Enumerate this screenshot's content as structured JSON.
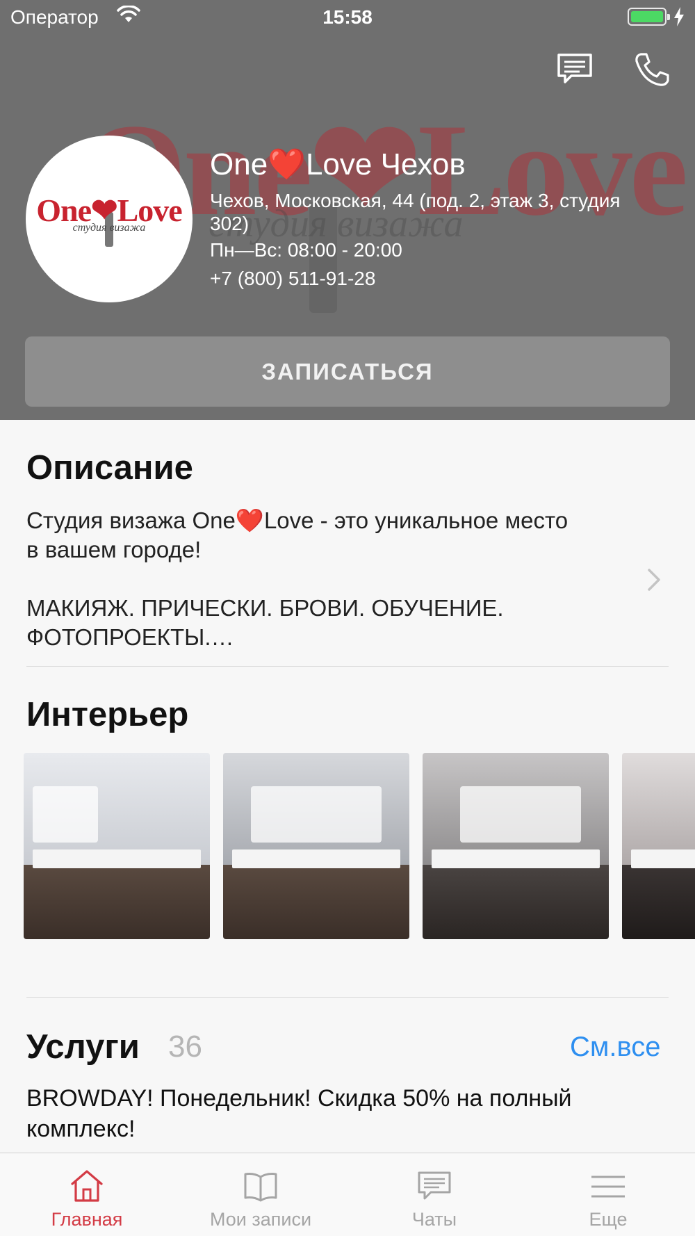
{
  "status_bar": {
    "carrier": "Оператор",
    "time": "15:58"
  },
  "header": {
    "background_logo_text": "One❤Love",
    "background_logo_subtitle": "студия визажа",
    "avatar_logo_text": "One❤Love",
    "avatar_logo_subtitle": "студия визажа",
    "name": "One❤️Love Чехов",
    "address": "Чехов, Московская, 44 (под. 2, этаж 3, студия 302)",
    "hours": "Пн—Вс: 08:00 - 20:00",
    "phone": "+7 (800) 511-91-28",
    "book_button": "ЗАПИСАТЬСЯ"
  },
  "description": {
    "title": "Описание",
    "paragraph_1": "Студия визажа One❤️Love - это уникальное место в вашем городе!",
    "paragraph_2": "МАКИЯЖ. ПРИЧЕСКИ. БРОВИ. ОБУЧЕНИЕ. ФОТОПРОЕКТЫ.…"
  },
  "interior": {
    "title": "Интерьер",
    "photo_count_visible": 4
  },
  "services": {
    "title": "Услуги",
    "count": "36",
    "see_all": "См.все",
    "first_item": "BROWDAY! Понедельник! Скидка 50% на полный комплекс!"
  },
  "tab_bar": {
    "tabs": [
      {
        "label": "Главная",
        "icon": "home-icon",
        "active": true
      },
      {
        "label": "Мои записи",
        "icon": "book-icon",
        "active": false
      },
      {
        "label": "Чаты",
        "icon": "chat-icon",
        "active": false
      },
      {
        "label": "Еще",
        "icon": "menu-icon",
        "active": false
      }
    ]
  },
  "colors": {
    "accent_red": "#d33b45",
    "link_blue": "#2e8ff0",
    "header_overlay": "#6f6f6f",
    "battery_green": "#4cd964"
  }
}
